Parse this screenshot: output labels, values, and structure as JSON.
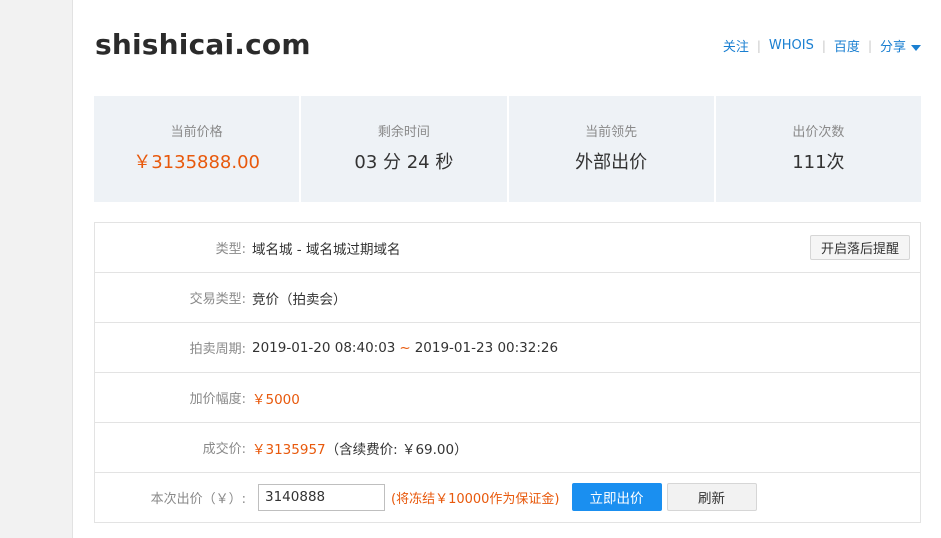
{
  "domain": "shishicai.com",
  "top_links": {
    "follow": "关注",
    "whois": "WHOIS",
    "baidu": "百度",
    "share": "分享"
  },
  "stats": [
    {
      "label": "当前价格",
      "value": "￥3135888.00"
    },
    {
      "label": "剩余时间",
      "value": "03 分 24 秒"
    },
    {
      "label": "当前领先",
      "value": "外部出价"
    },
    {
      "label": "出价次数",
      "value": "111次"
    }
  ],
  "details": {
    "type_label": "类型:",
    "type_value": "域名城 - 域名城过期域名",
    "remind_button": "开启落后提醒",
    "trade_label": "交易类型:",
    "trade_value": "竞价（拍卖会）",
    "period_label": "拍卖周期:",
    "period_start": "2019-01-20 08:40:03",
    "period_sep": "~",
    "period_end": "2019-01-23 00:32:26",
    "increment_label": "加价幅度:",
    "increment_value": "￥5000",
    "deal_label": "成交价:",
    "deal_value": "￥3135957",
    "deal_fee": "（含续费价: ￥69.00）",
    "bid_label": "本次出价（￥）:",
    "bid_value": "3140888",
    "freeze_note": "(将冻结￥10000作为保证金)",
    "submit_button": "立即出价",
    "refresh_button": "刷新"
  },
  "colors": {
    "link": "#1a7fd1",
    "price": "#e8590c",
    "primary_button": "#1a8ff0",
    "stat_bg": "#eef2f6"
  }
}
